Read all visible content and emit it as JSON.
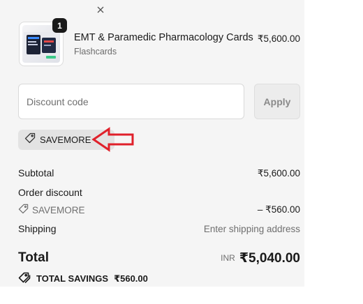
{
  "product": {
    "quantity": "1",
    "title": "EMT & Paramedic Pharmacology Cards",
    "subtitle": "Flashcards",
    "price": "₹5,600.00"
  },
  "discount": {
    "placeholder": "Discount code",
    "apply_label": "Apply",
    "applied_code": "SAVEMORE"
  },
  "summary": {
    "subtotal_label": "Subtotal",
    "subtotal_value": "₹5,600.00",
    "order_discount_label": "Order discount",
    "discount_code": "SAVEMORE",
    "discount_value": "– ₹560.00",
    "shipping_label": "Shipping",
    "shipping_value": "Enter shipping address",
    "total_label": "Total",
    "currency": "INR",
    "total_value": "₹5,040.00",
    "savings_label": "TOTAL SAVINGS",
    "savings_value": "₹560.00"
  },
  "colors": {
    "panel_bg": "#f5f5f5",
    "annotation_red": "#e0202a"
  },
  "icons": {
    "tag": "tag-icon",
    "remove": "close-icon",
    "savings": "tags-icon"
  }
}
